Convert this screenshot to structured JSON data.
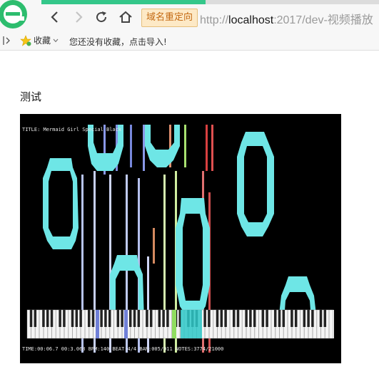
{
  "browser": {
    "logo_icon": "360-browser-logo-icon",
    "back_icon": "arrow-left-icon",
    "forward_icon": "arrow-right-icon",
    "reload_icon": "reload-icon",
    "home_icon": "home-icon",
    "redirect_badge": "域名重定向",
    "url_scheme": "http://",
    "url_host": "localhost",
    "url_rest": ":2017/dev-视频播放",
    "accent_color": "#34c78a"
  },
  "bookmarks": {
    "toggle_icon": "sidebar-toggle-icon",
    "favorites_icon": "star-icon",
    "favorites_label": "收藏",
    "dropdown_icon": "chevron-down-icon",
    "empty_message": "您还没有收藏，点击导入!"
  },
  "page": {
    "title": "测试"
  },
  "video": {
    "title_text": "TITLE: Mermaid Girl Special Black",
    "status_text": "TIME:00:06.7    00:3.068 BPM:140 BEAT:4/4 BAR:005/011 NOTES:3774/21000"
  }
}
